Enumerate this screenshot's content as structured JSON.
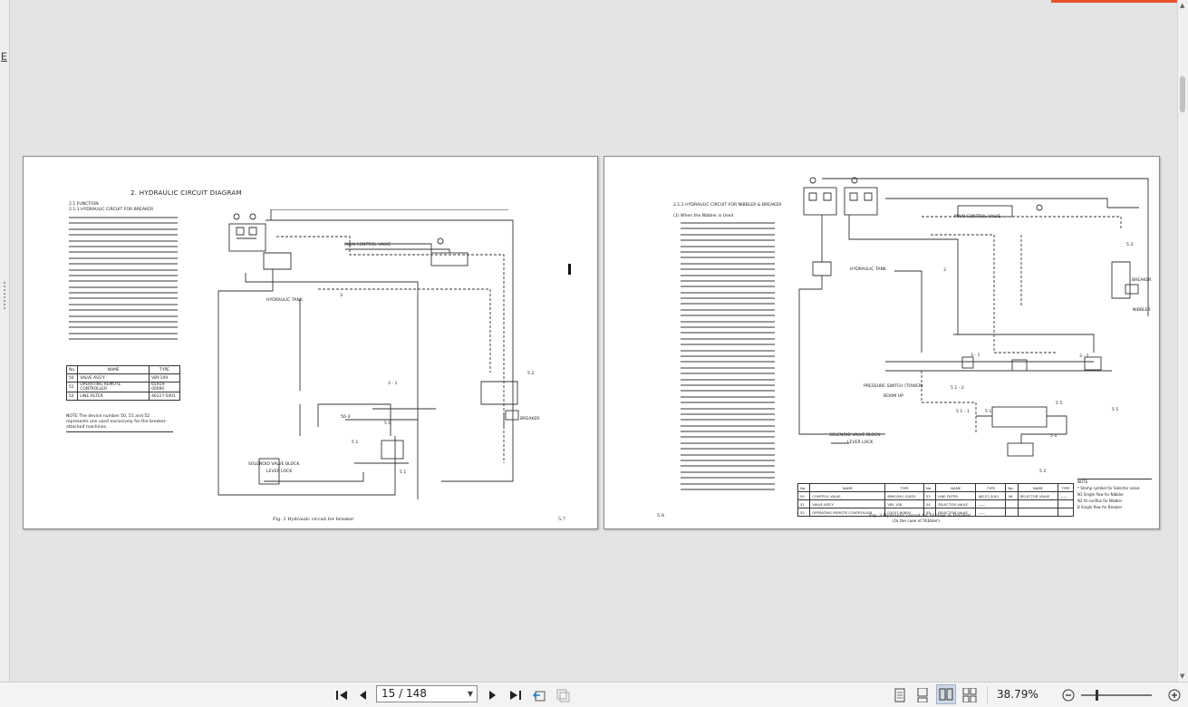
{
  "sidebar": {
    "label": "E"
  },
  "accent_color": "#e8542c",
  "page_left": {
    "heading": "2.  HYDRAULIC CIRCUIT DIAGRAM",
    "section_function": "2.1  FUNCTION",
    "section_breaker": "2.1.1  HYDRAULIC CIRCUIT FOR BREAKER",
    "labels": {
      "main_control_valve": "MAIN CONTROL VALVE",
      "hydraulic_tank": "HYDRAULIC TANK",
      "breaker": "BREAKER",
      "solenoid_valve_block": "SOLENOID VALVE BLOCK",
      "lever_lock": "LEVER LOCK",
      "n3": "3",
      "n3_1": "3 - 1",
      "n52": "5 2",
      "n50": "5 0",
      "n51": "5 1",
      "n51b": "5 1",
      "n50_3": "50-3"
    },
    "parts_table": {
      "headers": [
        "No.",
        "NAME",
        "TYPE"
      ],
      "rows": [
        [
          "50",
          "VALVE ASS'Y",
          "VBY-109"
        ],
        [
          "51",
          "OPERATING REMOTE CONTROLLER",
          "65919-00090"
        ],
        [
          "52",
          "LINE FILTER",
          "46227-5001"
        ]
      ]
    },
    "note": "NOTE  The device number 50, 51 and 52 represents one used exclusively for the breaker-attached machines.",
    "caption": "Fig. 2   Hydraulic circuit for breaker",
    "page_number": "5.7"
  },
  "page_right": {
    "section": "2.1.2  HYDRAULIC CIRCUIT FOR NIBBLER & BREAKER",
    "subsection": "(1)  When the Nibbler is Used",
    "labels": {
      "main_control_valve": "MAIN CONTROL VALVE",
      "hydraulic_tank": "HYDRAULIC TANK",
      "breaker": "BREAKER",
      "nibbler": "NIBBLER",
      "pressure_switch": "PRESSURE SWITCH (TOWER)",
      "boom_up": "BOOM UP",
      "solenoid_valve_block": "SOLENOID VALVE BLOCK",
      "lever_lock": "LEVER LOCK",
      "n53": "5 3",
      "n3": "3",
      "n3_1": "3 - 1",
      "n3_2": "3 - 2",
      "n51_2": "5 1 - 2",
      "n51_1": "5 1 - 1",
      "n51": "5 1",
      "n55a": "5 5",
      "n55b": "5 5",
      "n50": "5 0",
      "n52": "5 2"
    },
    "parts_table": {
      "headers": [
        "No.",
        "NAME",
        "TYPE",
        "No.",
        "NAME",
        "TYPE",
        "No.",
        "NAME",
        "TYPE"
      ],
      "rows": [
        [
          "50",
          "CONTROL VALVE",
          "6MX158 I 01825",
          "53",
          "LINE FILTER",
          "46227-5001",
          "56",
          "SELECTOR VALVE",
          "——"
        ],
        [
          "51",
          "VALVE ASS'Y",
          "VBY 108",
          "54",
          "SELECTOR VALVE",
          "——",
          "",
          "",
          ""
        ],
        [
          "52",
          "OPERATING REMOTE CONTROLLER",
          "07037-90800",
          "55",
          "SELECTOR VALVE",
          "——",
          "",
          "",
          ""
        ]
      ]
    },
    "note": {
      "title": "NOTE",
      "lines": [
        "*  Stamp symbol for Selector valve",
        "N1  Single flow for Nibbler",
        "N2  At confluo for Nibbler",
        "B   Single flow for Breaker"
      ]
    },
    "caption": "Fig. 3   Hydraulic circuit for Nibbler & Breaker",
    "caption_sub": "(In the case of Nibbler)",
    "page_number": "5.8"
  },
  "toolbar": {
    "page_display": "15 / 148",
    "zoom": "38.79%"
  }
}
